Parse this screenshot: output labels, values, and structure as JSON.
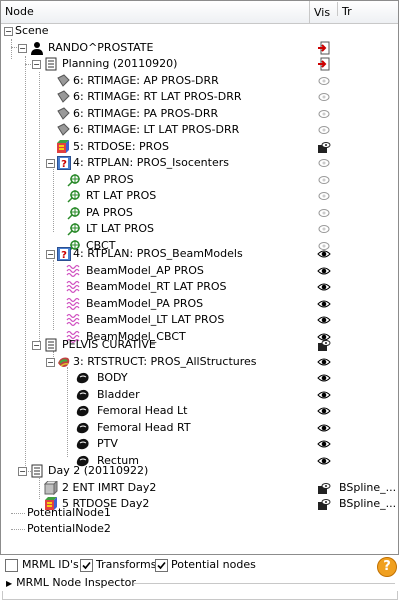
{
  "header": {
    "node": "Node",
    "vis": "Vis",
    "tr": "Tr"
  },
  "tree": {
    "scene": "Scene",
    "patient": "RANDO^PROSTATE",
    "study1": "Planning (20110920)",
    "rtimage1": "6: RTIMAGE: AP PROS-DRR",
    "rtimage2": "6: RTIMAGE: RT LAT PROS-DRR",
    "rtimage3": "6: RTIMAGE: PA PROS-DRR",
    "rtimage4": "6: RTIMAGE: LT LAT PROS-DRR",
    "rtdose1": "5: RTDOSE: PROS",
    "rtplan1": "4: RTPLAN: PROS_Isocenters",
    "iso1": "AP PROS",
    "iso2": "RT LAT PROS",
    "iso3": "PA PROS",
    "iso4": "LT LAT PROS",
    "iso5": "CBCT",
    "rtplan2": "4: RTPLAN: PROS_BeamModels",
    "beam1": "BeamModel_AP PROS",
    "beam2": "BeamModel_RT LAT PROS",
    "beam3": "BeamModel_PA PROS",
    "beam4": "BeamModel_LT LAT PROS",
    "beam5": "BeamModel_CBCT",
    "pelvis": "PELVIS CURATIVE",
    "rtstruct": "3: RTSTRUCT: PROS_AllStructures",
    "s1": "BODY",
    "s2": "Bladder",
    "s3": "Femoral Head Lt",
    "s4": "Femoral Head RT",
    "s5": "PTV",
    "s6": "Rectum",
    "study2": "Day 2 (20110922)",
    "day2a": "2 ENT IMRT Day2",
    "day2b": "5 RTDOSE Day2",
    "day2a_tr": "BSpline_...",
    "day2b_tr": "BSpline_...",
    "pot1": "PotentialNode1",
    "pot2": "PotentialNode2"
  },
  "options": {
    "mrml_ids": "MRML ID's",
    "transforms": "Transforms",
    "potential_nodes": "Potential nodes",
    "mrml_ids_checked": false,
    "transforms_checked": true,
    "potential_nodes_checked": true
  },
  "inspector": {
    "label": "MRML Node Inspector"
  },
  "icons": {
    "help": "?",
    "twisty_open": "−",
    "unknown": "?"
  }
}
